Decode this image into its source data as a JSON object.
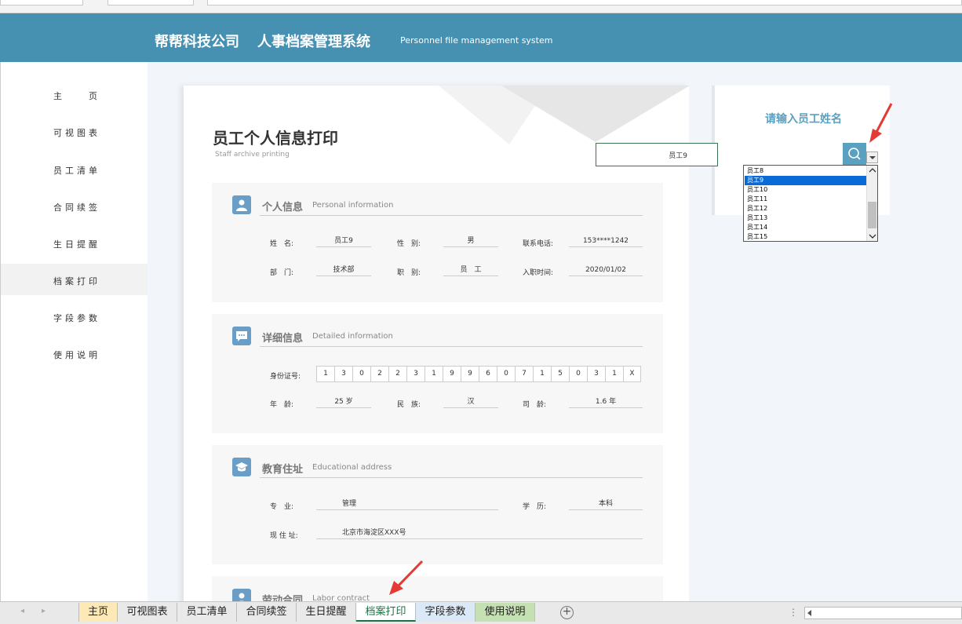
{
  "header": {
    "company": "帮帮科技公司",
    "system": "人事档案管理系统",
    "subtitle": "Personnel file management system"
  },
  "sidebar": {
    "items": [
      {
        "label": "主　　页"
      },
      {
        "label": "可视图表"
      },
      {
        "label": "员工清单"
      },
      {
        "label": "合同续签"
      },
      {
        "label": "生日提醒"
      },
      {
        "label": "档案打印",
        "active": true
      },
      {
        "label": "字段参数"
      },
      {
        "label": "使用说明"
      }
    ]
  },
  "card": {
    "title": "员工个人信息打印",
    "subtitle": "Staff archive printing"
  },
  "personal": {
    "title": "个人信息",
    "title_en": "Personal information",
    "name_label": "姓　名:",
    "name": "员工9",
    "gender_label": "性　别:",
    "gender": "男",
    "phone_label": "联系电话:",
    "phone": "153****1242",
    "dept_label": "部　门:",
    "dept": "技术部",
    "rank_label": "职　别:",
    "rank": "员　工",
    "hire_label": "入职时间:",
    "hire": "2020/01/02"
  },
  "detail": {
    "title": "详细信息",
    "title_en": "Detailed information",
    "id_label": "身份证号:",
    "id_digits": [
      "1",
      "3",
      "0",
      "2",
      "2",
      "3",
      "1",
      "9",
      "9",
      "6",
      "0",
      "7",
      "1",
      "5",
      "0",
      "3",
      "1",
      "X"
    ],
    "age_label": "年　龄:",
    "age": "25 岁",
    "ethnic_label": "民　族:",
    "ethnic": "汉",
    "tenure_label": "司　龄:",
    "tenure": "1.6 年"
  },
  "edu": {
    "title": "教育住址",
    "title_en": "Educational address",
    "major_label": "专　业:",
    "major": "管理",
    "degree_label": "学　历:",
    "degree": "本科",
    "address_label": "现 住 址:",
    "address": "北京市海淀区XXX号"
  },
  "labor": {
    "title": "劳动合同",
    "title_en": "Labor contract"
  },
  "search": {
    "prompt": "请输入员工姓名",
    "value": "员工9",
    "options": [
      "员工8",
      "员工9",
      "员工10",
      "员工11",
      "员工12",
      "员工13",
      "员工14",
      "员工15"
    ],
    "selected": "员工9"
  },
  "tabs": [
    {
      "label": "主页",
      "color": "#fde9b8"
    },
    {
      "label": "可视图表"
    },
    {
      "label": "员工清单"
    },
    {
      "label": "合同续签"
    },
    {
      "label": "生日提醒"
    },
    {
      "label": "档案打印",
      "active": true
    },
    {
      "label": "字段参数",
      "color": "#dbe8f5"
    },
    {
      "label": "使用说明",
      "color": "#c5e0b3"
    }
  ],
  "colors": {
    "header": "#4691b2",
    "accent": "#5aa0c0",
    "active_tab": "#1e7145"
  }
}
